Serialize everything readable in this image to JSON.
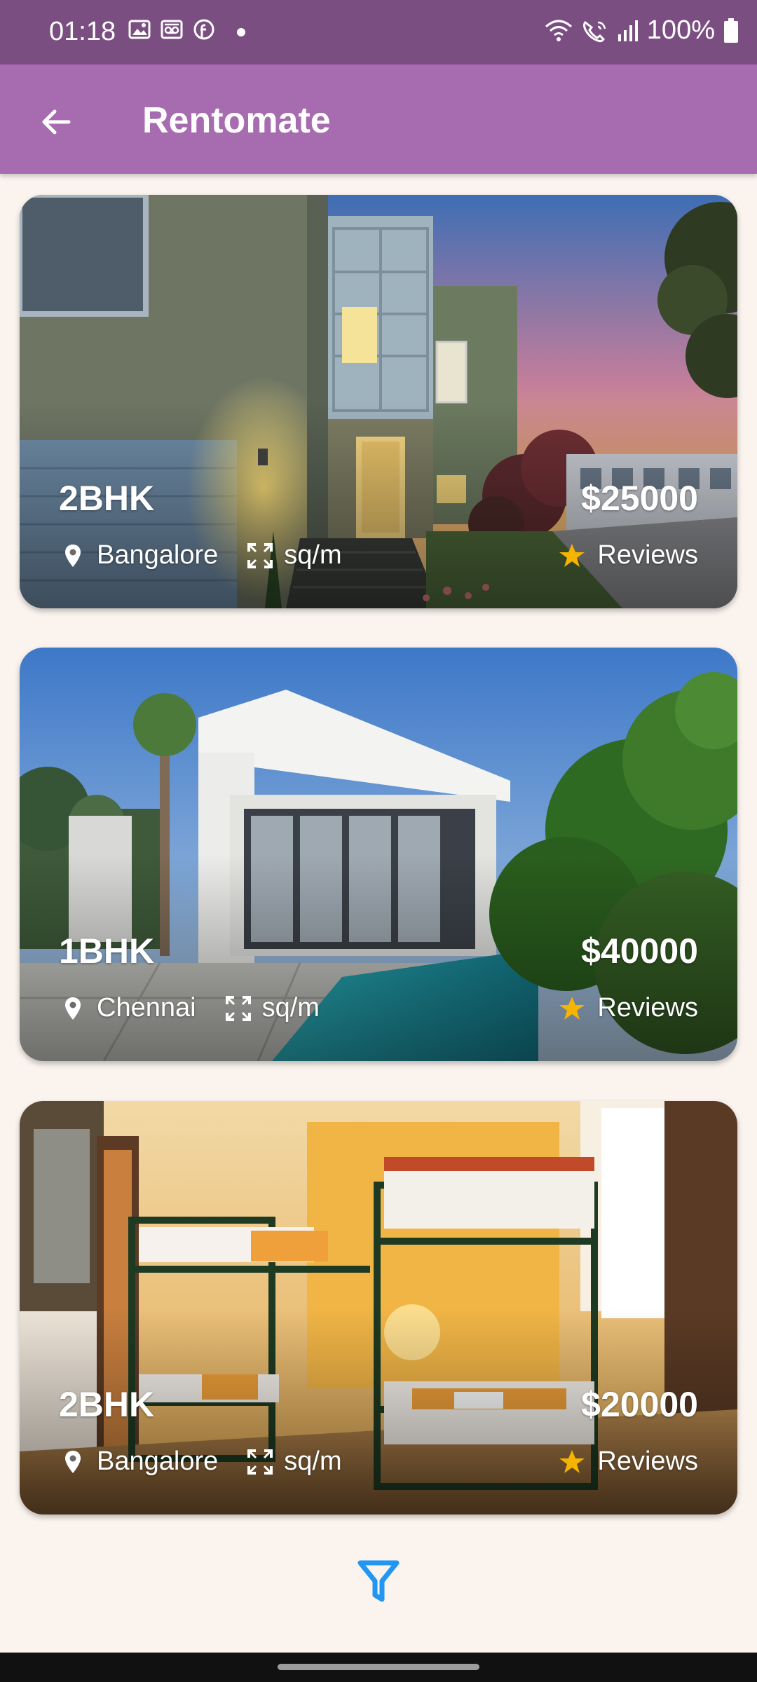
{
  "status_bar": {
    "time": "01:18",
    "battery": "100%",
    "icons": [
      "image-icon",
      "voicemail-icon",
      "facebook-icon",
      "dot-icon",
      "wifi-icon",
      "wifi-calling-icon",
      "signal-icon",
      "battery-icon"
    ]
  },
  "app_bar": {
    "title": "Rentomate",
    "back_icon": "arrow-back-icon"
  },
  "listings": [
    {
      "type": "2BHK",
      "location": "Bangalore",
      "area": "sq/m",
      "price": "$25000",
      "reviews": "Reviews"
    },
    {
      "type": "1BHK",
      "location": "Chennai",
      "area": "sq/m",
      "price": "$40000",
      "reviews": "Reviews"
    },
    {
      "type": "2BHK",
      "location": "Bangalore",
      "area": "sq/m",
      "price": "$20000",
      "reviews": "Reviews"
    }
  ],
  "filter": {
    "icon": "filter-icon"
  },
  "colors": {
    "status_bar": "#7B4E82",
    "app_bar": "#A76BB0",
    "background": "#FAF3EE",
    "star": "#F4B400",
    "filter": "#2196F3"
  }
}
